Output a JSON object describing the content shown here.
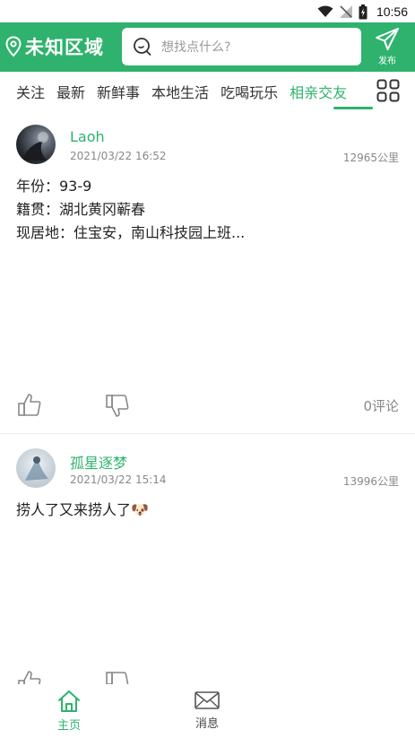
{
  "status_bar": {
    "time": "10:56"
  },
  "header": {
    "location": "未知区域",
    "search_placeholder": "想找点什么?",
    "publish_label": "发布"
  },
  "tabs": [
    {
      "label": "关注"
    },
    {
      "label": "最新"
    },
    {
      "label": "新鲜事"
    },
    {
      "label": "本地生活"
    },
    {
      "label": "吃喝玩乐"
    },
    {
      "label": "相亲交友",
      "active": true
    }
  ],
  "posts": [
    {
      "username": "Laoh",
      "date": "2021/03/22 16:52",
      "distance": "12965公里",
      "lines": [
        "年份：93-9",
        "籍贯：湖北黄冈蕲春",
        "现居地：住宝安，南山科技园上班..."
      ],
      "comments": "0评论"
    },
    {
      "username": "孤星逐梦",
      "date": "2021/03/22 15:14",
      "distance": "13996公里",
      "lines": [
        "捞人了又来捞人了🐶"
      ]
    }
  ],
  "bottom_nav": [
    {
      "label": "主页",
      "icon": "home-icon",
      "active": true
    },
    {
      "label": "消息",
      "icon": "mail-icon",
      "active": false
    }
  ],
  "colors": {
    "accent": "#2fb26d"
  }
}
